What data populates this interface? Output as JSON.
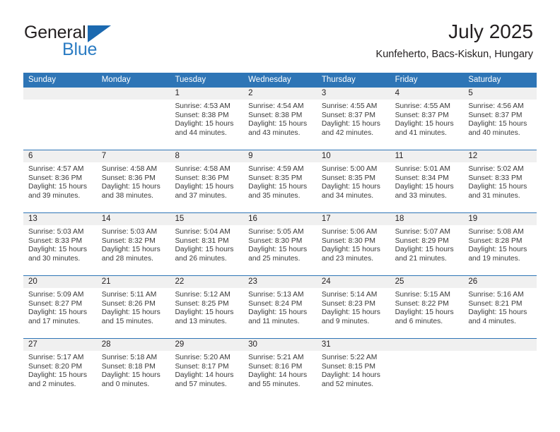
{
  "brand": {
    "name_part1": "General",
    "name_part2": "Blue",
    "triangle_icon": "blue-triangle-logo-mark"
  },
  "header": {
    "title": "July 2025",
    "subtitle": "Kunfeherto, Bacs-Kiskun, Hungary"
  },
  "colors": {
    "header_blue": "#2e75b6",
    "brand_blue": "#2b7cc3",
    "daynum_band": "#f0f0f0",
    "text": "#231f20",
    "body_text": "#3a3a3a"
  },
  "labels": {
    "sunrise_prefix": "Sunrise:",
    "sunset_prefix": "Sunset:",
    "daylight_prefix": "Daylight:"
  },
  "weekdays": [
    "Sunday",
    "Monday",
    "Tuesday",
    "Wednesday",
    "Thursday",
    "Friday",
    "Saturday"
  ],
  "weeks": [
    [
      {
        "day": "",
        "empty": true
      },
      {
        "day": "",
        "empty": true
      },
      {
        "day": "1",
        "sunrise": "Sunrise: 4:53 AM",
        "sunset": "Sunset: 8:38 PM",
        "daylight_l1": "Daylight: 15 hours",
        "daylight_l2": "and 44 minutes."
      },
      {
        "day": "2",
        "sunrise": "Sunrise: 4:54 AM",
        "sunset": "Sunset: 8:38 PM",
        "daylight_l1": "Daylight: 15 hours",
        "daylight_l2": "and 43 minutes."
      },
      {
        "day": "3",
        "sunrise": "Sunrise: 4:55 AM",
        "sunset": "Sunset: 8:37 PM",
        "daylight_l1": "Daylight: 15 hours",
        "daylight_l2": "and 42 minutes."
      },
      {
        "day": "4",
        "sunrise": "Sunrise: 4:55 AM",
        "sunset": "Sunset: 8:37 PM",
        "daylight_l1": "Daylight: 15 hours",
        "daylight_l2": "and 41 minutes."
      },
      {
        "day": "5",
        "sunrise": "Sunrise: 4:56 AM",
        "sunset": "Sunset: 8:37 PM",
        "daylight_l1": "Daylight: 15 hours",
        "daylight_l2": "and 40 minutes."
      }
    ],
    [
      {
        "day": "6",
        "sunrise": "Sunrise: 4:57 AM",
        "sunset": "Sunset: 8:36 PM",
        "daylight_l1": "Daylight: 15 hours",
        "daylight_l2": "and 39 minutes."
      },
      {
        "day": "7",
        "sunrise": "Sunrise: 4:58 AM",
        "sunset": "Sunset: 8:36 PM",
        "daylight_l1": "Daylight: 15 hours",
        "daylight_l2": "and 38 minutes."
      },
      {
        "day": "8",
        "sunrise": "Sunrise: 4:58 AM",
        "sunset": "Sunset: 8:36 PM",
        "daylight_l1": "Daylight: 15 hours",
        "daylight_l2": "and 37 minutes."
      },
      {
        "day": "9",
        "sunrise": "Sunrise: 4:59 AM",
        "sunset": "Sunset: 8:35 PM",
        "daylight_l1": "Daylight: 15 hours",
        "daylight_l2": "and 35 minutes."
      },
      {
        "day": "10",
        "sunrise": "Sunrise: 5:00 AM",
        "sunset": "Sunset: 8:35 PM",
        "daylight_l1": "Daylight: 15 hours",
        "daylight_l2": "and 34 minutes."
      },
      {
        "day": "11",
        "sunrise": "Sunrise: 5:01 AM",
        "sunset": "Sunset: 8:34 PM",
        "daylight_l1": "Daylight: 15 hours",
        "daylight_l2": "and 33 minutes."
      },
      {
        "day": "12",
        "sunrise": "Sunrise: 5:02 AM",
        "sunset": "Sunset: 8:33 PM",
        "daylight_l1": "Daylight: 15 hours",
        "daylight_l2": "and 31 minutes."
      }
    ],
    [
      {
        "day": "13",
        "sunrise": "Sunrise: 5:03 AM",
        "sunset": "Sunset: 8:33 PM",
        "daylight_l1": "Daylight: 15 hours",
        "daylight_l2": "and 30 minutes."
      },
      {
        "day": "14",
        "sunrise": "Sunrise: 5:03 AM",
        "sunset": "Sunset: 8:32 PM",
        "daylight_l1": "Daylight: 15 hours",
        "daylight_l2": "and 28 minutes."
      },
      {
        "day": "15",
        "sunrise": "Sunrise: 5:04 AM",
        "sunset": "Sunset: 8:31 PM",
        "daylight_l1": "Daylight: 15 hours",
        "daylight_l2": "and 26 minutes."
      },
      {
        "day": "16",
        "sunrise": "Sunrise: 5:05 AM",
        "sunset": "Sunset: 8:30 PM",
        "daylight_l1": "Daylight: 15 hours",
        "daylight_l2": "and 25 minutes."
      },
      {
        "day": "17",
        "sunrise": "Sunrise: 5:06 AM",
        "sunset": "Sunset: 8:30 PM",
        "daylight_l1": "Daylight: 15 hours",
        "daylight_l2": "and 23 minutes."
      },
      {
        "day": "18",
        "sunrise": "Sunrise: 5:07 AM",
        "sunset": "Sunset: 8:29 PM",
        "daylight_l1": "Daylight: 15 hours",
        "daylight_l2": "and 21 minutes."
      },
      {
        "day": "19",
        "sunrise": "Sunrise: 5:08 AM",
        "sunset": "Sunset: 8:28 PM",
        "daylight_l1": "Daylight: 15 hours",
        "daylight_l2": "and 19 minutes."
      }
    ],
    [
      {
        "day": "20",
        "sunrise": "Sunrise: 5:09 AM",
        "sunset": "Sunset: 8:27 PM",
        "daylight_l1": "Daylight: 15 hours",
        "daylight_l2": "and 17 minutes."
      },
      {
        "day": "21",
        "sunrise": "Sunrise: 5:11 AM",
        "sunset": "Sunset: 8:26 PM",
        "daylight_l1": "Daylight: 15 hours",
        "daylight_l2": "and 15 minutes."
      },
      {
        "day": "22",
        "sunrise": "Sunrise: 5:12 AM",
        "sunset": "Sunset: 8:25 PM",
        "daylight_l1": "Daylight: 15 hours",
        "daylight_l2": "and 13 minutes."
      },
      {
        "day": "23",
        "sunrise": "Sunrise: 5:13 AM",
        "sunset": "Sunset: 8:24 PM",
        "daylight_l1": "Daylight: 15 hours",
        "daylight_l2": "and 11 minutes."
      },
      {
        "day": "24",
        "sunrise": "Sunrise: 5:14 AM",
        "sunset": "Sunset: 8:23 PM",
        "daylight_l1": "Daylight: 15 hours",
        "daylight_l2": "and 9 minutes."
      },
      {
        "day": "25",
        "sunrise": "Sunrise: 5:15 AM",
        "sunset": "Sunset: 8:22 PM",
        "daylight_l1": "Daylight: 15 hours",
        "daylight_l2": "and 6 minutes."
      },
      {
        "day": "26",
        "sunrise": "Sunrise: 5:16 AM",
        "sunset": "Sunset: 8:21 PM",
        "daylight_l1": "Daylight: 15 hours",
        "daylight_l2": "and 4 minutes."
      }
    ],
    [
      {
        "day": "27",
        "sunrise": "Sunrise: 5:17 AM",
        "sunset": "Sunset: 8:20 PM",
        "daylight_l1": "Daylight: 15 hours",
        "daylight_l2": "and 2 minutes."
      },
      {
        "day": "28",
        "sunrise": "Sunrise: 5:18 AM",
        "sunset": "Sunset: 8:18 PM",
        "daylight_l1": "Daylight: 15 hours",
        "daylight_l2": "and 0 minutes."
      },
      {
        "day": "29",
        "sunrise": "Sunrise: 5:20 AM",
        "sunset": "Sunset: 8:17 PM",
        "daylight_l1": "Daylight: 14 hours",
        "daylight_l2": "and 57 minutes."
      },
      {
        "day": "30",
        "sunrise": "Sunrise: 5:21 AM",
        "sunset": "Sunset: 8:16 PM",
        "daylight_l1": "Daylight: 14 hours",
        "daylight_l2": "and 55 minutes."
      },
      {
        "day": "31",
        "sunrise": "Sunrise: 5:22 AM",
        "sunset": "Sunset: 8:15 PM",
        "daylight_l1": "Daylight: 14 hours",
        "daylight_l2": "and 52 minutes."
      },
      {
        "day": "",
        "empty": true
      },
      {
        "day": "",
        "empty": true
      }
    ]
  ]
}
